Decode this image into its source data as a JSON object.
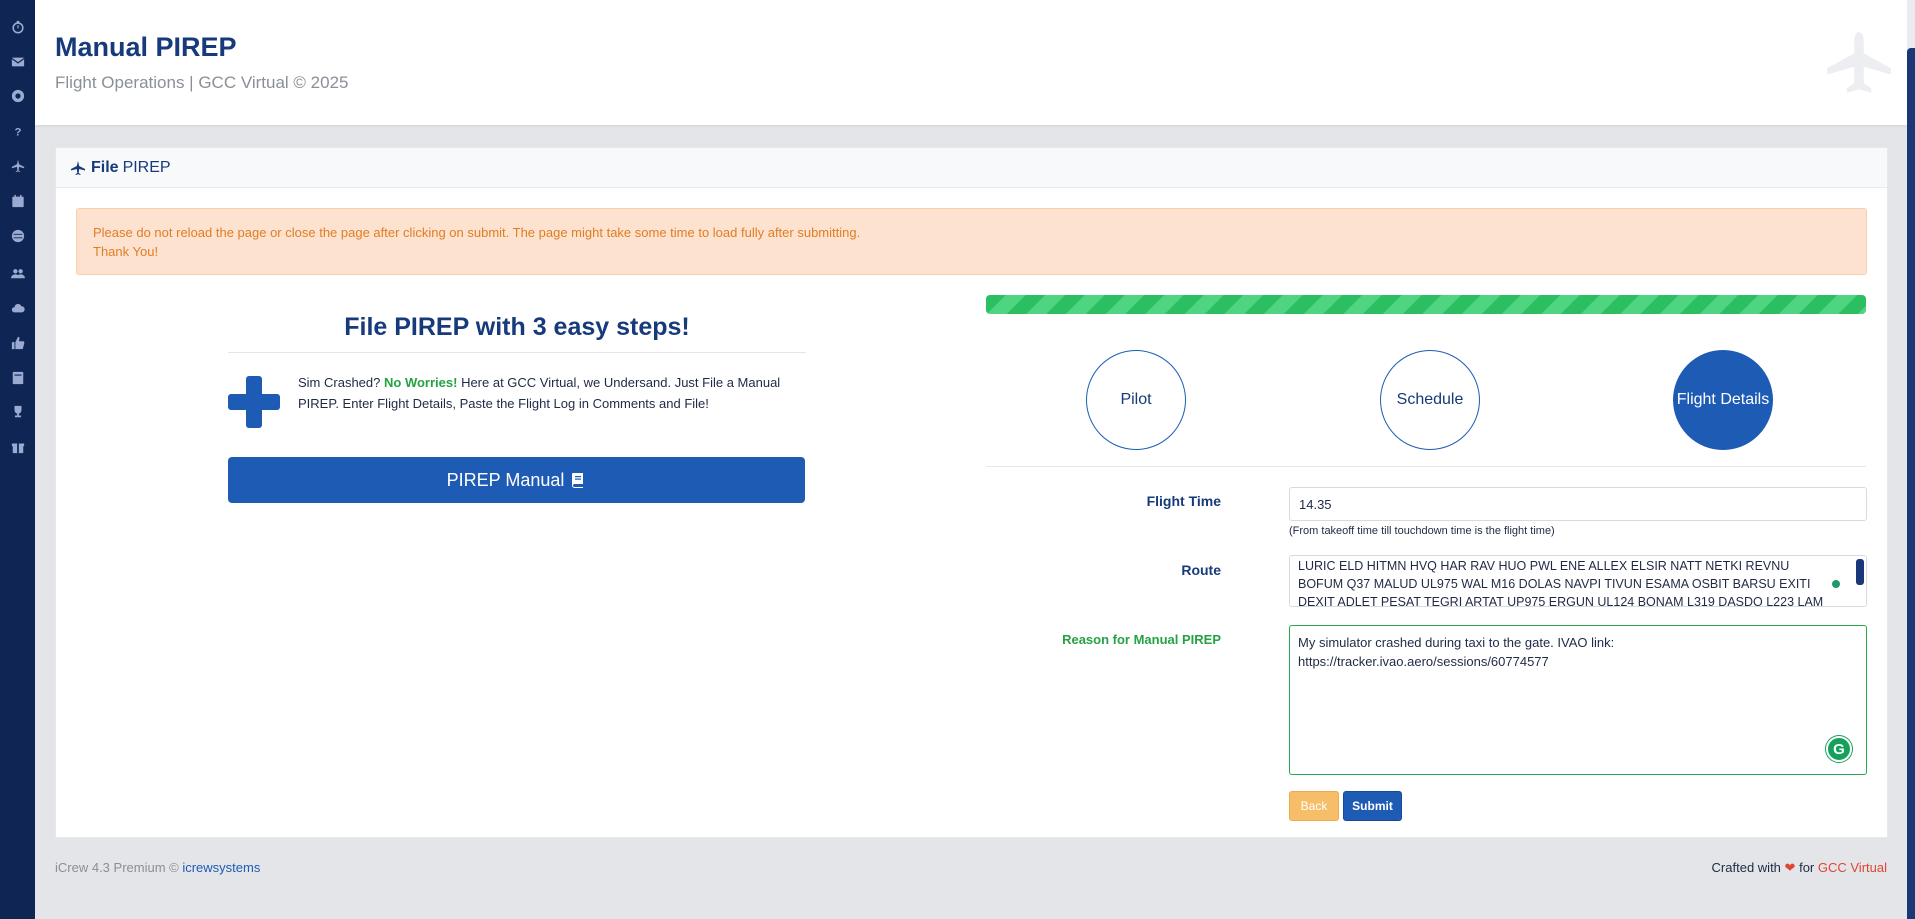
{
  "header": {
    "title": "Manual PIREP",
    "subtitle": "Flight Operations | GCC Virtual © 2025"
  },
  "sidebar": {
    "icons": [
      "stopwatch-icon",
      "envelope-icon",
      "life-ring-icon",
      "question-icon",
      "plane-icon",
      "calendar-icon",
      "globe-icon",
      "users-icon",
      "cloud-icon",
      "thumbs-up-icon",
      "book-icon",
      "trophy-icon",
      "gift-icon"
    ]
  },
  "card": {
    "header_bold": "File",
    "header_rest": "PIREP",
    "alert_line1": "Please do not reload the page or close the page after clicking on submit. The page might take some time to load fully after submitting.",
    "alert_line2": "Thank You!"
  },
  "steps": {
    "title": "File PIREP with 3 easy steps!",
    "desc_part1": "Sim Crashed?",
    "desc_green": "No Worries!",
    "desc_part2": "Here at GCC Virtual, we Undersand. Just File a Manual PIREP. Enter Flight Details, Paste the Flight Log in Comments and File!",
    "manual_button": "PIREP Manual"
  },
  "wizard": {
    "progress_percent": 100,
    "steps": [
      "Pilot",
      "Schedule",
      "Flight Details"
    ],
    "active_step": "Flight Details"
  },
  "form": {
    "flight_time_label": "Flight Time",
    "flight_time_value": "14.35",
    "flight_time_help": "(From takeoff time till touchdown time is the flight time)",
    "route_label": "Route",
    "route_value": "LURIC ELD HITMN HVQ HAR RAV HUO PWL ENE ALLEX ELSIR NATT NETKI REVNU BOFUM Q37 MALUD UL975 WAL M16 DOLAS NAVPI TIVUN ESAMA OSBIT BARSU EXITI DEXIT ADLET PESAT TEGRI ARTAT UP975 ERGUN UL124 BONAM L319 DASDO L223 LAM",
    "reason_label": "Reason for Manual PIREP",
    "reason_value": "My simulator crashed during taxi to the gate. IVAO link: https://tracker.ivao.aero/sessions/60774577",
    "back_button": "Back",
    "submit_button": "Submit"
  },
  "footer": {
    "left_text": "iCrew 4.3 Premium ©",
    "left_link": "icrewsystems",
    "right_text": "Crafted with",
    "right_heart": "❤",
    "right_for": "for",
    "right_brand": "GCC Virtual"
  },
  "colors": {
    "sidebar": "#0f2553",
    "primary": "#1e5bb5",
    "success": "#25a244",
    "warning": "#f7be69",
    "alert_bg": "#fde3cf",
    "alert_text": "#e07d25"
  }
}
